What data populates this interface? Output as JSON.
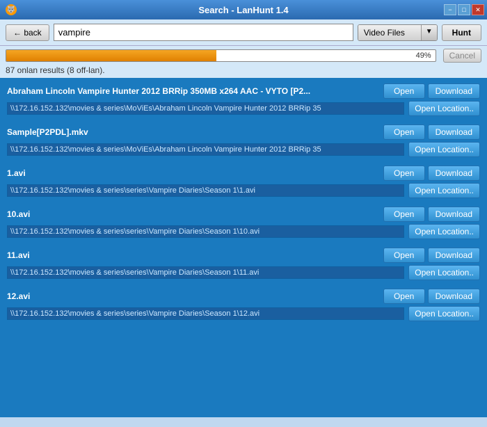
{
  "window": {
    "title": "Search - LanHunt 1.4",
    "controls": {
      "minimize": "−",
      "maximize": "□",
      "close": "✕"
    }
  },
  "toolbar": {
    "back_label": "← back",
    "search_value": "vampire",
    "filetype_label": "Video Files",
    "dropdown_arrow": "▼",
    "hunt_label": "Hunt"
  },
  "progress": {
    "fill_percent": 49,
    "text": "49%",
    "cancel_label": "Cancel"
  },
  "results_label": "87 onlan results (8 off-lan).",
  "results": [
    {
      "filename": "Abraham Lincoln Vampire Hunter 2012 BRRip 350MB x264 AAC - VYTO [P2...",
      "path": "\\\\172.16.152.132\\movies & series\\MoViEs\\Abraham Lincoln Vampire Hunter 2012 BRRip 35",
      "open_label": "Open",
      "download_label": "Download",
      "open_location_label": "Open Location.."
    },
    {
      "filename": "Sample[P2PDL].mkv",
      "path": "\\\\172.16.152.132\\movies & series\\MoViEs\\Abraham Lincoln Vampire Hunter 2012 BRRip 35",
      "open_label": "Open",
      "download_label": "Download",
      "open_location_label": "Open Location.."
    },
    {
      "filename": "1.avi",
      "path": "\\\\172.16.152.132\\movies & series\\series\\Vampire Diaries\\Season 1\\1.avi",
      "open_label": "Open",
      "download_label": "Download",
      "open_location_label": "Open Location.."
    },
    {
      "filename": "10.avi",
      "path": "\\\\172.16.152.132\\movies & series\\series\\Vampire Diaries\\Season 1\\10.avi",
      "open_label": "Open",
      "download_label": "Download",
      "open_location_label": "Open Location.."
    },
    {
      "filename": "11.avi",
      "path": "\\\\172.16.152.132\\movies & series\\series\\Vampire Diaries\\Season 1\\11.avi",
      "open_label": "Open",
      "download_label": "Download",
      "open_location_label": "Open Location.."
    },
    {
      "filename": "12.avi",
      "path": "\\\\172.16.152.132\\movies & series\\series\\Vampire Diaries\\Season 1\\12.avi",
      "open_label": "Open",
      "download_label": "Download",
      "open_location_label": "Open Location.."
    }
  ]
}
